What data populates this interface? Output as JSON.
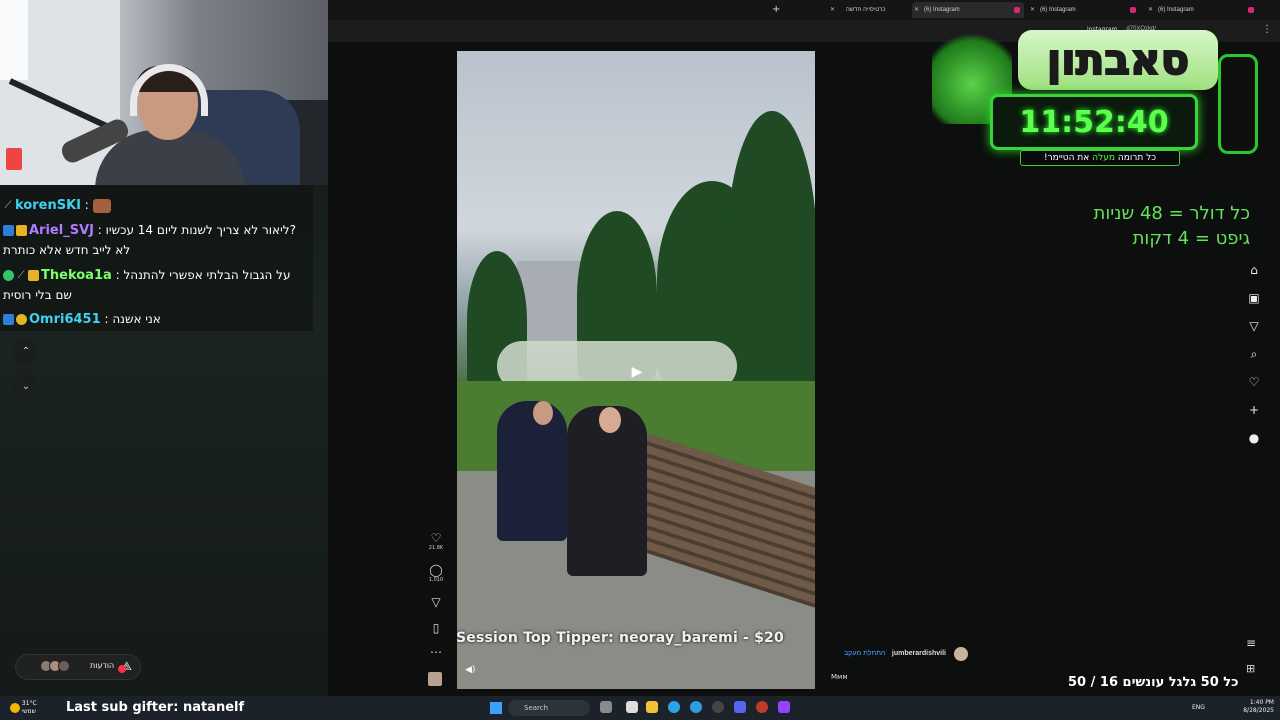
{
  "browser": {
    "tabs": [
      {
        "label": "כרטיסייה חדשה"
      },
      {
        "label": "(6) Instagram"
      },
      {
        "label": "(6) Instagram"
      },
      {
        "label": "(6) Instagram"
      }
    ],
    "new_tab": "+",
    "url_fragment": "d70XOzkd/"
  },
  "chat": {
    "messages": [
      {
        "user": "korenSKI",
        "text": ""
      },
      {
        "user": "Ariel_SVJ",
        "text": "ליאור לא צריך לשנות ליום 14 עכשיו?",
        "line2": "לא לייב חדש אלא כותרת"
      },
      {
        "user": "Thekoa1a",
        "text": "על הגבול הבלתי אפשרי להתנהל",
        "line2": "שם בלי רוסית"
      },
      {
        "user": "Omri6451",
        "text": "אני אשנה"
      }
    ],
    "user_colors": {
      "korenSKI": "#40d0f0",
      "Ariel_SVJ": "#b07cff",
      "Thekoa1a": "#7dff6a",
      "Omri6451": "#40d0f0"
    }
  },
  "nav": {
    "up": "⌃",
    "down": "⌄"
  },
  "messages_pill": {
    "label": "הודעות"
  },
  "post": {
    "likes": "21.8K",
    "comments": "1,010",
    "author": "jumberardishvili",
    "follow": "התחלת מעקב",
    "caption": "Ммм"
  },
  "overlay": {
    "top_tipper": "Session Top Tipper: neoray_baremi - $20",
    "last_sub": "Last sub gifter: natanelf",
    "subathon_title": "סאבתון",
    "timer": "11:52:40",
    "tagline_pre": "כל תרומה",
    "tagline_hl": "מעלה",
    "tagline_post": "את הטיימר!",
    "rate_dollar": "כל דולר = 48 שניות",
    "rate_gift": "גיפט = 4 דקות",
    "goal": "כל 50 גלגל עונשים 16 / 50",
    "ig_label": "instagram"
  },
  "taskbar": {
    "weather_temp": "31°C",
    "weather_desc": "שמשי",
    "search": "Search",
    "lang": "ENG",
    "time": "1:40 PM",
    "date": "8/28/2025"
  },
  "colors": {
    "accent_green": "#62e35a",
    "ig_notif": "#ff3040"
  }
}
